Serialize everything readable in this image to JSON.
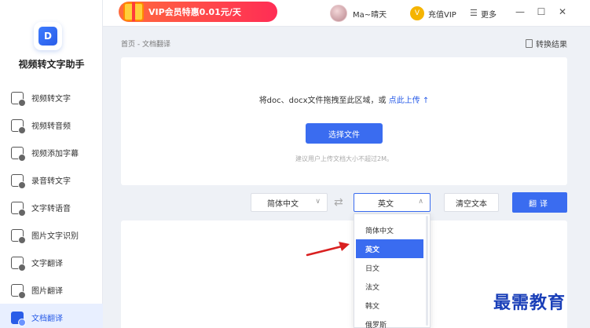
{
  "app": {
    "name": "视频转文字助手",
    "logo_glyph": "D"
  },
  "topbar": {
    "vip_banner": "VIP会员特惠0.01元/天",
    "username": "Ma~晴天",
    "vip_charge": "充值VIP",
    "vip_icon_glyph": "V",
    "more_label": "更多",
    "more_icon_glyph": "☰",
    "minimize_glyph": "—",
    "maximize_glyph": "☐",
    "close_glyph": "✕"
  },
  "sidebar": {
    "items": [
      {
        "label": "视频转文字",
        "icon": "video-text-icon"
      },
      {
        "label": "视频转音频",
        "icon": "video-audio-icon"
      },
      {
        "label": "视频添加字幕",
        "icon": "subtitle-icon"
      },
      {
        "label": "录音转文字",
        "icon": "mic-text-icon"
      },
      {
        "label": "文字转语音",
        "icon": "text-speech-icon"
      },
      {
        "label": "图片文字识别",
        "icon": "image-ocr-icon"
      },
      {
        "label": "文字翻译",
        "icon": "text-translate-icon"
      },
      {
        "label": "图片翻译",
        "icon": "image-translate-icon"
      },
      {
        "label": "文档翻译",
        "icon": "doc-translate-icon",
        "active": true
      }
    ]
  },
  "breadcrumb": "首页 - 文档翻译",
  "result_link": "转换结果",
  "upload": {
    "hint": "将doc、docx文件拖拽至此区域，或 ",
    "hint_link": "点此上传",
    "hint_arrow": "↑",
    "choose_button": "选择文件",
    "note": "建议用户上传文档大小不超过2M。"
  },
  "controls": {
    "source_lang": "简体中文",
    "target_lang": "英文",
    "swap_glyph": "⇄",
    "chevron_down": "∨",
    "chevron_up": "∧",
    "clear_button": "清空文本",
    "translate_button": "翻译"
  },
  "dropdown": {
    "options": [
      "简体中文",
      "英文",
      "日文",
      "法文",
      "韩文",
      "俄罗斯"
    ],
    "selected_index": 1
  },
  "watermark": "最需教育",
  "colors": {
    "accent": "#3a6cf0",
    "banner": "#ff2d55",
    "arrow": "#d92020"
  }
}
